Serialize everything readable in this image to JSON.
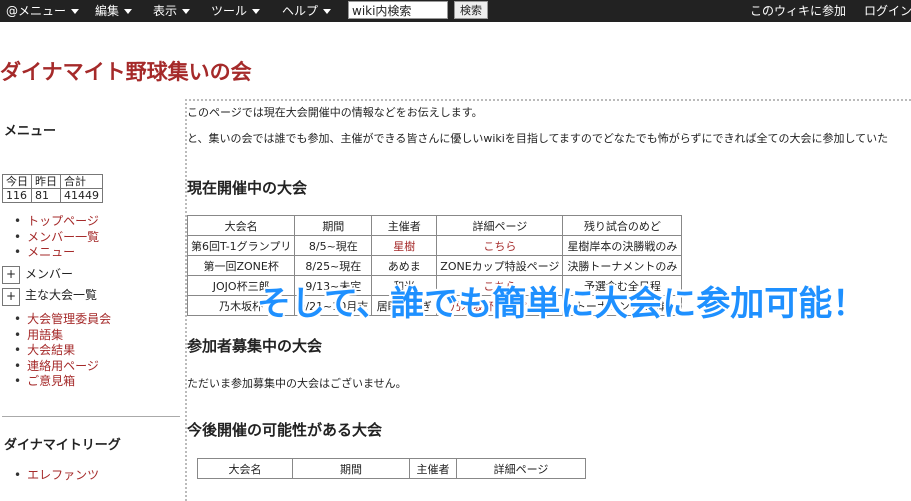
{
  "topbar": {
    "menus": [
      {
        "label": "@メニュー"
      },
      {
        "label": "編集"
      },
      {
        "label": "表示"
      },
      {
        "label": "ツール"
      },
      {
        "label": "ヘルプ"
      }
    ],
    "search_value": "wiki内検索",
    "search_button": "検索",
    "join_link": "このウィキに参加",
    "login_link": "ログイン"
  },
  "site_title": "ダイナマイト野球集いの会",
  "sidebar": {
    "menu_heading": "メニュー",
    "counter": {
      "headers": [
        "今日",
        "昨日",
        "合計"
      ],
      "values": [
        "116",
        "81",
        "41449"
      ]
    },
    "links_top": [
      "トップページ",
      "メンバー一覧",
      "メニュー"
    ],
    "toggles": [
      {
        "symbol": "+",
        "label": "メンバー"
      },
      {
        "symbol": "+",
        "label": "主な大会一覧"
      }
    ],
    "links_bottom": [
      "大会管理委員会",
      "用語集",
      "大会結果",
      "連絡用ページ",
      "ご意見箱"
    ],
    "league_heading": "ダイナマイトリーグ",
    "league_links": [
      "エレファンツ"
    ]
  },
  "content": {
    "intro1": "このページでは現在大会開催中の情報などをお伝えします。",
    "intro2": "と、集いの会では誰でも参加、主催ができる皆さんに優しいwikiを目指してますのでどなたでも怖がらずにできれば全ての大会に参加していた",
    "section_current": "現在開催中の大会",
    "current_table": {
      "headers": [
        "大会名",
        "期間",
        "主催者",
        "詳細ページ",
        "残り試合のめど"
      ],
      "rows": [
        [
          "第6回T-1グランプリ",
          "8/5~現在",
          "星樹",
          "こちら",
          "星樹岸本の決勝戦のみ"
        ],
        [
          "第一回ZONE杯",
          "8/25~現在",
          "あめま",
          "ZONEカップ特設ページ",
          "決勝トーナメントのみ"
        ],
        [
          "JOJO杯三郎",
          "9/13~未定",
          "和光",
          "こちら",
          "予選含む全日程"
        ],
        [
          "乃木坂杯",
          "9/21~10月末",
          "居眠うさぎ",
          "乃木坂杯特設ページ",
          "トーナメント1回戦"
        ]
      ]
    },
    "section_recruit": "参加者募集中の大会",
    "recruit_text": "ただいま参加募集中の大会はございません。",
    "section_future": "今後開催の可能性がある大会",
    "future_table": {
      "headers": [
        "大会名",
        "期間",
        "主催者",
        "詳細ページ"
      ]
    }
  },
  "overlay_text": "そして、誰でも簡単に大会に参加可能！",
  "colors": {
    "title": "#a52a2a",
    "link": "#a52a2a",
    "overlay": "#1e90ff",
    "topbar": "#222222"
  }
}
